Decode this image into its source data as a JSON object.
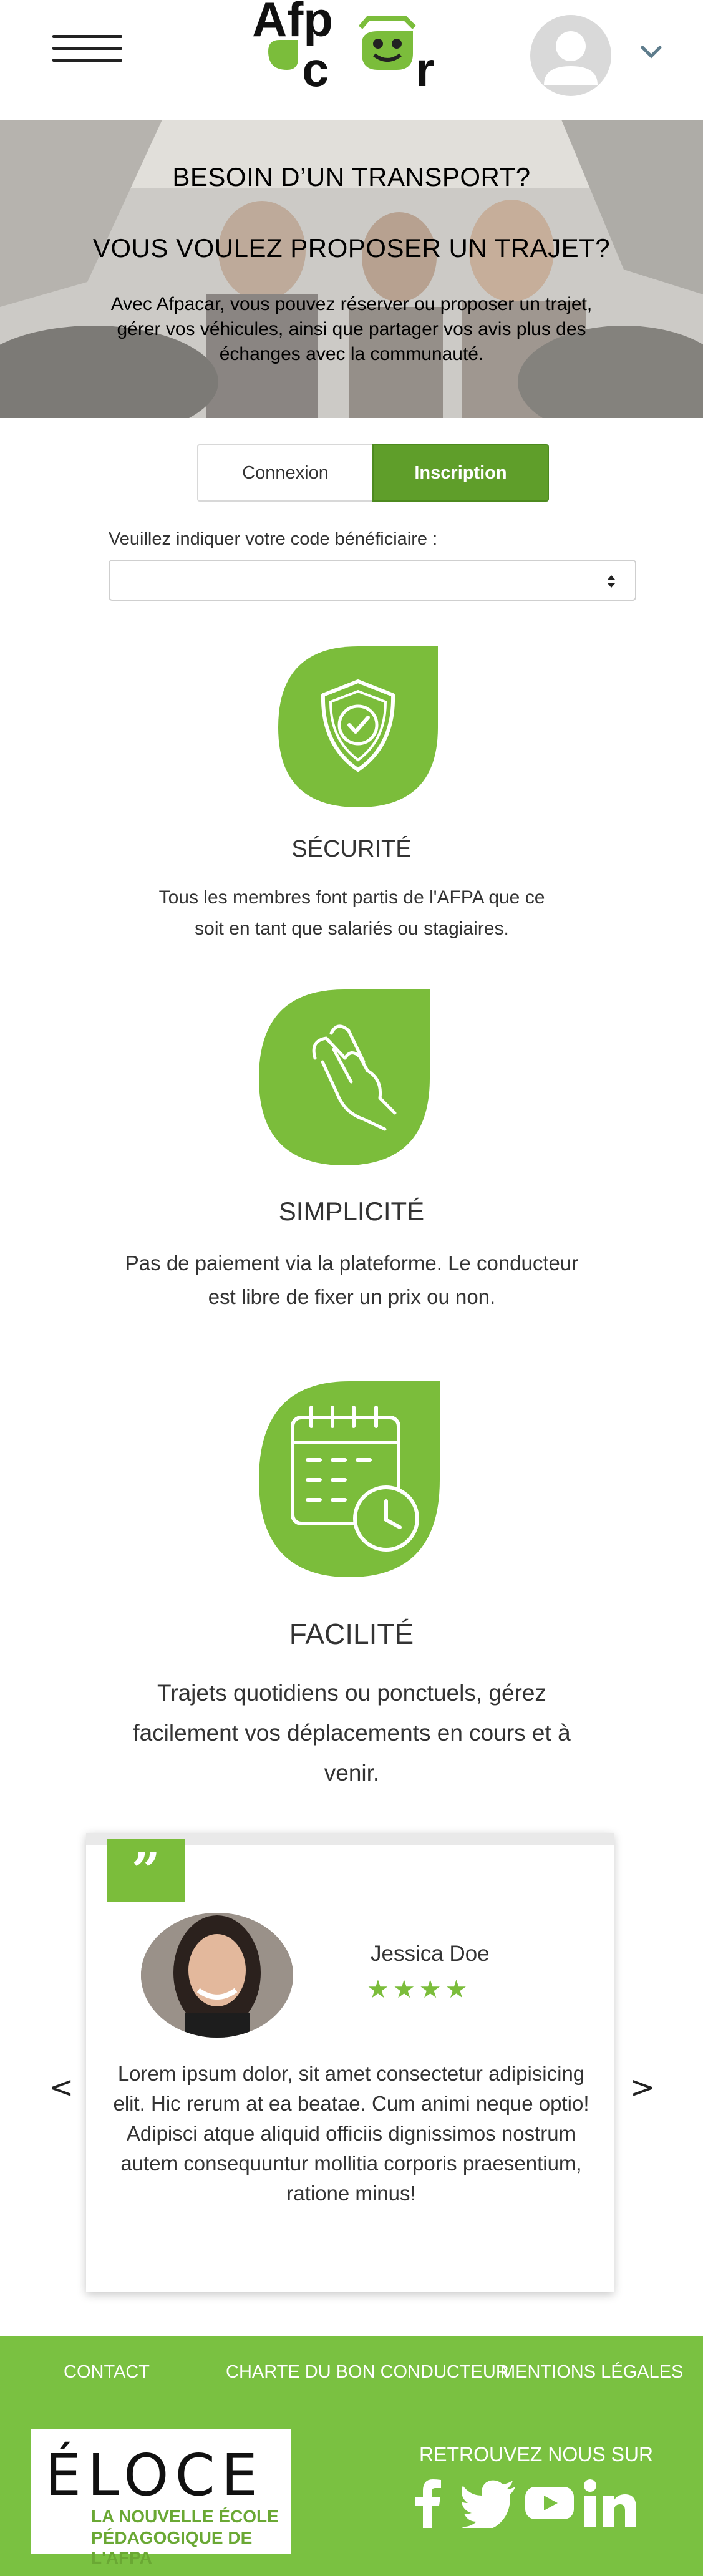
{
  "header": {
    "menu_icon": "hamburger-icon",
    "logo_text_1": "Afp",
    "logo_text_2": "c",
    "logo_text_3": "r",
    "account_icon": "user-avatar-icon",
    "dropdown_icon": "chevron-down-icon"
  },
  "hero": {
    "title_1": "BESOIN D’UN TRANSPORT?",
    "title_2": "VOUS VOULEZ PROPOSER UN TRAJET?",
    "description": "Avec Afpacar, vous pouvez réserver ou proposer un trajet, gérer vos véhicules, ainsi que partager vos avis plus des échanges avec la communauté."
  },
  "auth": {
    "login_tab": "Connexion",
    "signup_tab": "Inscription",
    "active_tab": "Inscription",
    "code_label": "Veuillez indiquer votre code bénéficiaire :",
    "code_value": ""
  },
  "features": [
    {
      "icon": "shield-check-icon",
      "title": "SÉCURITÉ",
      "text": "Tous les membres font partis de l'AFPA que ce soit en tant que salariés ou stagiaires."
    },
    {
      "icon": "hand-gesture-icon",
      "title": "SIMPLICITÉ",
      "text": "Pas de paiement via la plateforme. Le conducteur est libre de fixer un prix ou non."
    },
    {
      "icon": "calendar-clock-icon",
      "title": "FACILITÉ",
      "text": "Trajets quotidiens ou ponctuels, gérez facilement vos déplacements en cours et à venir."
    }
  ],
  "testimonial": {
    "quote_mark": "”",
    "name": "Jessica Doe",
    "rating": 4,
    "stars": "★★★★",
    "text": "Lorem ipsum dolor, sit amet consectetur adipisicing elit. Hic rerum at ea beatae. Cum animi neque optio! Adipisci atque aliquid officiis dignissimos nostrum autem consequuntur mollitia corporis praesentium, ratione minus!",
    "prev": "<",
    "next": ">"
  },
  "footer": {
    "links": [
      "CONTACT",
      "CHARTE DU BON CONDUCTEUR",
      "MENTIONS LÉGALES"
    ],
    "partner_brand": "ÉLOCE",
    "partner_line_1": "LA NOUVELLE ÉCOLE",
    "partner_line_2": "PÉDAGOGIQUE DE L'AFPA",
    "follow_label": "RETROUVEZ NOUS SUR",
    "socials": [
      "facebook-icon",
      "twitter-icon",
      "youtube-icon",
      "linkedin-icon"
    ]
  },
  "colors": {
    "brand_green": "#7ac141",
    "tab_active": "#5f9e2a",
    "icon_green": "#7bbd3b",
    "text_dark": "#333333"
  }
}
